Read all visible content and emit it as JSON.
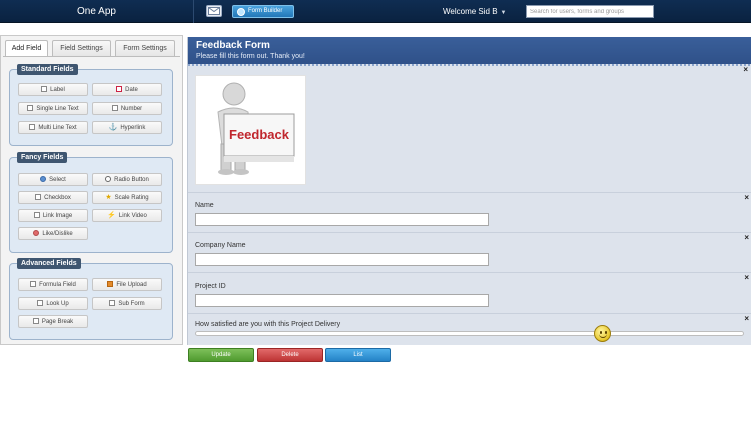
{
  "app": {
    "title": "One App"
  },
  "topbar": {
    "mail_icon": "envelope-icon",
    "form_builder_label": "Form Builder",
    "welcome_text": "Welcome Sid B",
    "search_placeholder": "Search for users, forms and groups"
  },
  "left_panel": {
    "tabs": [
      {
        "label": "Add Field",
        "active": true
      },
      {
        "label": "Field Settings",
        "active": false
      },
      {
        "label": "Form Settings",
        "active": false
      }
    ],
    "groups": [
      {
        "title": "Standard Fields",
        "items": [
          {
            "label": "Label",
            "icon": "label-icon"
          },
          {
            "label": "Date",
            "icon": "calendar-icon"
          },
          {
            "label": "Single Line Text",
            "icon": "single-line-text-icon"
          },
          {
            "label": "Number",
            "icon": "number-icon"
          },
          {
            "label": "Multi Line Text",
            "icon": "multi-line-text-icon"
          },
          {
            "label": "Hyperlink",
            "icon": "anchor-icon"
          }
        ]
      },
      {
        "title": "Fancy Fields",
        "items": [
          {
            "label": "Select",
            "icon": "select-icon"
          },
          {
            "label": "Radio Button",
            "icon": "radio-icon"
          },
          {
            "label": "Checkbox",
            "icon": "checkbox-icon"
          },
          {
            "label": "Scale Rating",
            "icon": "star-icon"
          },
          {
            "label": "Link Image",
            "icon": "image-icon"
          },
          {
            "label": "Link Video",
            "icon": "video-icon"
          },
          {
            "label": "Like/Dislike",
            "icon": "like-icon"
          }
        ]
      },
      {
        "title": "Advanced Fields",
        "items": [
          {
            "label": "Formula Field",
            "icon": "formula-icon"
          },
          {
            "label": "File Upload",
            "icon": "upload-icon"
          },
          {
            "label": "Look Up",
            "icon": "lookup-icon"
          },
          {
            "label": "Sub Form",
            "icon": "subform-icon"
          },
          {
            "label": "Page Break",
            "icon": "page-break-icon"
          }
        ]
      }
    ]
  },
  "form": {
    "title": "Feedback Form",
    "description": "Please fill this form out. Thank you!",
    "image_text": "Feedback",
    "fields": [
      {
        "label": "Name",
        "value": ""
      },
      {
        "label": "Company Name",
        "value": ""
      },
      {
        "label": "Project ID",
        "value": ""
      }
    ],
    "rating": {
      "label": "How satisfied are you with this Project Delivery",
      "value": 0.75
    },
    "remove_label": "×"
  },
  "actions": {
    "update": "Update",
    "delete": "Delete",
    "list": "List"
  }
}
